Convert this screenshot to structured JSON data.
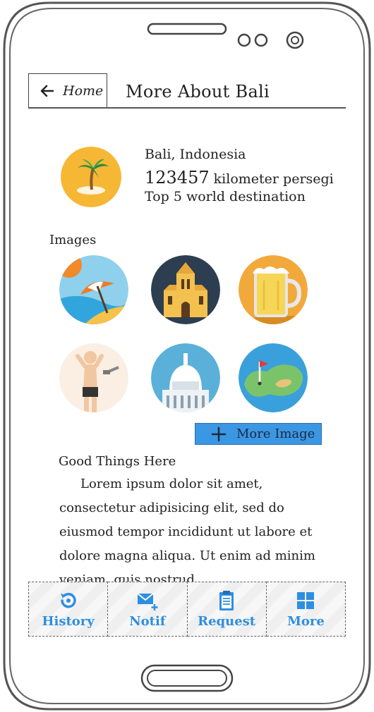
{
  "header": {
    "back_label": "Home",
    "title": "More About Bali"
  },
  "info": {
    "location": "Bali, Indonesia",
    "area_number": "123457",
    "area_unit": " kilometer persegi",
    "ranking": "Top 5 world destination"
  },
  "images": {
    "label": "Images",
    "items": [
      {
        "icon": "beach-umbrella-icon"
      },
      {
        "icon": "cathedral-icon"
      },
      {
        "icon": "beer-mug-icon"
      },
      {
        "icon": "shower-person-icon"
      },
      {
        "icon": "capitol-building-icon"
      },
      {
        "icon": "golf-course-icon"
      }
    ],
    "more_label": "More Image"
  },
  "good_things": {
    "label": "Good Things Here",
    "text": "Lorem ipsum dolor sit amet, consectetur adipisicing elit, sed do eiusmod tempor incididunt ut labore et dolore magna aliqua. Ut enim ad minim veniam, quis nostrud"
  },
  "nav": {
    "items": [
      {
        "label": "History",
        "icon": "history-icon"
      },
      {
        "label": "Notif",
        "icon": "mail-plus-icon"
      },
      {
        "label": "Request",
        "icon": "clipboard-icon"
      },
      {
        "label": "More",
        "icon": "grid-icon"
      }
    ]
  },
  "colors": {
    "accent": "#2e8fe0",
    "button_fill": "#3b97e3",
    "island_bg": "#f6b734"
  }
}
